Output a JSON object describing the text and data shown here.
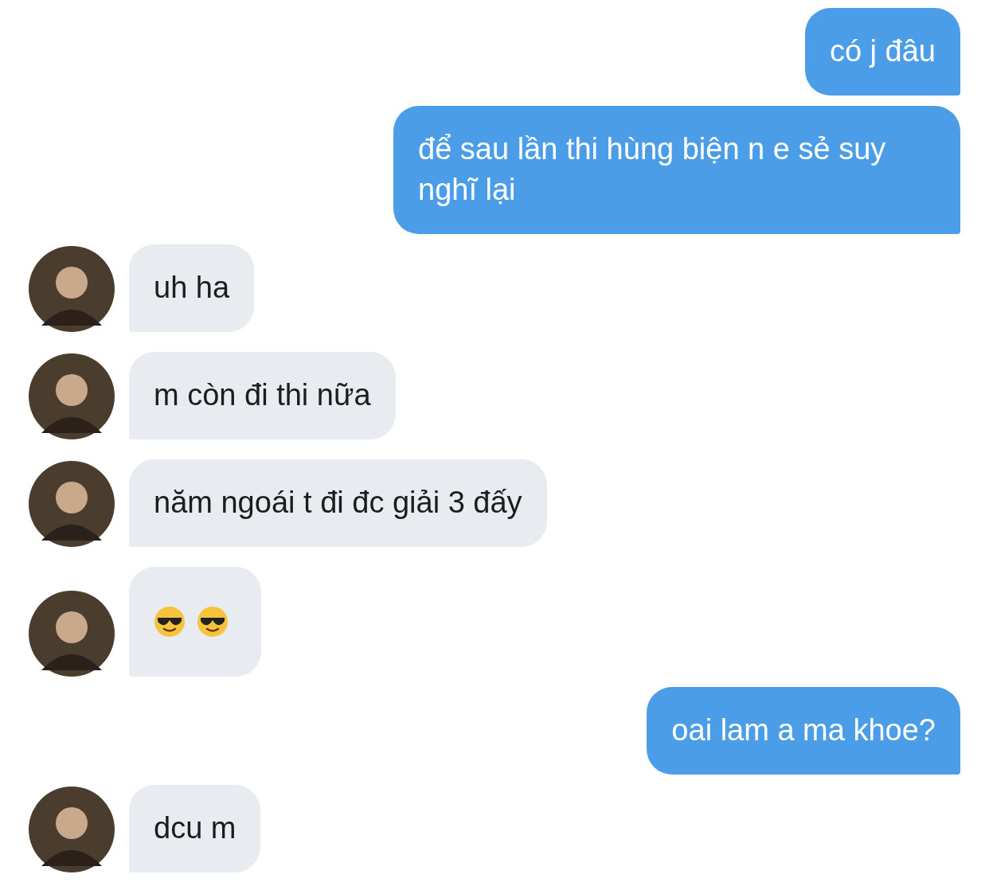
{
  "messages": [
    {
      "sent": true,
      "kind": "text",
      "text": "có j đâu"
    },
    {
      "sent": true,
      "kind": "text",
      "text": "để sau lần thi hùng biện n e sẻ suy nghĩ lại"
    },
    {
      "sent": false,
      "kind": "text",
      "text": "uh ha"
    },
    {
      "sent": false,
      "kind": "text",
      "text": "m còn đi thi nữa"
    },
    {
      "sent": false,
      "kind": "text",
      "text": "năm ngoái t đi đc giải 3 đấy"
    },
    {
      "sent": false,
      "kind": "emoji",
      "items": [
        {
          "kind": "sunglasses"
        },
        {
          "kind": "sunglasses"
        }
      ]
    },
    {
      "sent": true,
      "kind": "text",
      "text": "oai lam a ma khoe?"
    },
    {
      "sent": false,
      "kind": "text",
      "text": "dcu m"
    }
  ]
}
